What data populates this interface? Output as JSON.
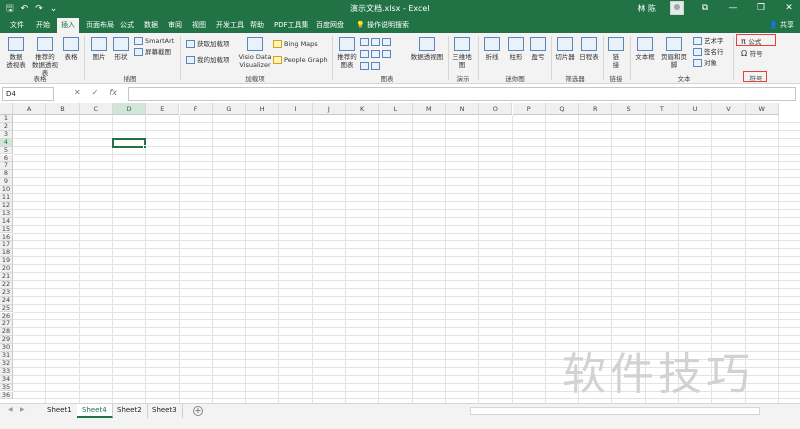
{
  "window": {
    "title": "演示文档.xlsx  -  Excel",
    "user_name": "林 陈",
    "share_label": "共享",
    "qat": {
      "save": "🖫",
      "undo": "↶",
      "redo": "↷",
      "customize": "⌄"
    },
    "controls": {
      "ribbon_opts": "⧉",
      "minimize": "—",
      "restore": "❐",
      "close": "✕"
    }
  },
  "tabs": [
    "文件",
    "开始",
    "插入",
    "页面布局",
    "公式",
    "数据",
    "审阅",
    "视图",
    "开发工具",
    "帮助",
    "PDF工具集",
    "百度网盘"
  ],
  "active_tab": "插入",
  "tell_me": "操作说明搜索",
  "ribbon": {
    "tables": {
      "pivot": "数据\n透视表",
      "recommended_pivot": "推荐的\n数据透视表",
      "table": "表格",
      "group": "表格"
    },
    "illustrations": {
      "pictures": "图片",
      "shapes": "形状",
      "smartart": "SmartArt",
      "screenshot": "屏幕截图",
      "group": "插图"
    },
    "addins": {
      "get_addins": "获取加载项",
      "my_addins": "我的加载项",
      "visio": "Visio Data\nVisualizer",
      "bing_maps": "Bing Maps",
      "people_graph": "People Graph",
      "group": "加载项"
    },
    "charts": {
      "recommended": "推荐的\n图表",
      "pivot_chart": "数据透视图",
      "group": "图表"
    },
    "tours": {
      "map3d": "三维地\n图",
      "group": "演示"
    },
    "sparklines": {
      "line": "折线",
      "column": "柱形",
      "winloss": "盈亏",
      "group": "迷你图"
    },
    "filters": {
      "slicer": "切片器",
      "timeline": "日程表",
      "group": "筛选器"
    },
    "links": {
      "link": "链\n接",
      "group": "链接"
    },
    "text": {
      "textbox": "文本框",
      "header_footer": "页眉和页脚",
      "wordart": "艺术字",
      "signature": "签名行",
      "object": "对象",
      "group": "文本"
    },
    "symbols": {
      "equation": "公式",
      "symbol": "符号",
      "group": "符号"
    }
  },
  "formula_bar": {
    "name_box": "D4",
    "cancel": "✕",
    "enter": "✓",
    "fx": "fx",
    "value": ""
  },
  "grid": {
    "columns": [
      "A",
      "B",
      "C",
      "D",
      "E",
      "F",
      "G",
      "H",
      "I",
      "J",
      "K",
      "L",
      "M",
      "N",
      "O",
      "P",
      "Q",
      "R",
      "S",
      "T",
      "U",
      "V",
      "W"
    ],
    "rows": [
      "1",
      "2",
      "3",
      "4",
      "5",
      "6",
      "7",
      "8",
      "9",
      "10",
      "11",
      "12",
      "13",
      "14",
      "15",
      "16",
      "17",
      "18",
      "19",
      "20",
      "21",
      "22",
      "23",
      "24",
      "25",
      "26",
      "27",
      "28",
      "29",
      "30",
      "31",
      "32",
      "33",
      "34",
      "35",
      "36"
    ],
    "active_cell": "D4",
    "active_col": "D",
    "active_row": "4"
  },
  "sheets": [
    "Sheet1",
    "Sheet4",
    "Sheet2",
    "Sheet3"
  ],
  "active_sheet": "Sheet4",
  "add_sheet": "+",
  "watermark": "软件技巧",
  "colors": {
    "brand": "#217346",
    "highlight": "#e0433c"
  }
}
